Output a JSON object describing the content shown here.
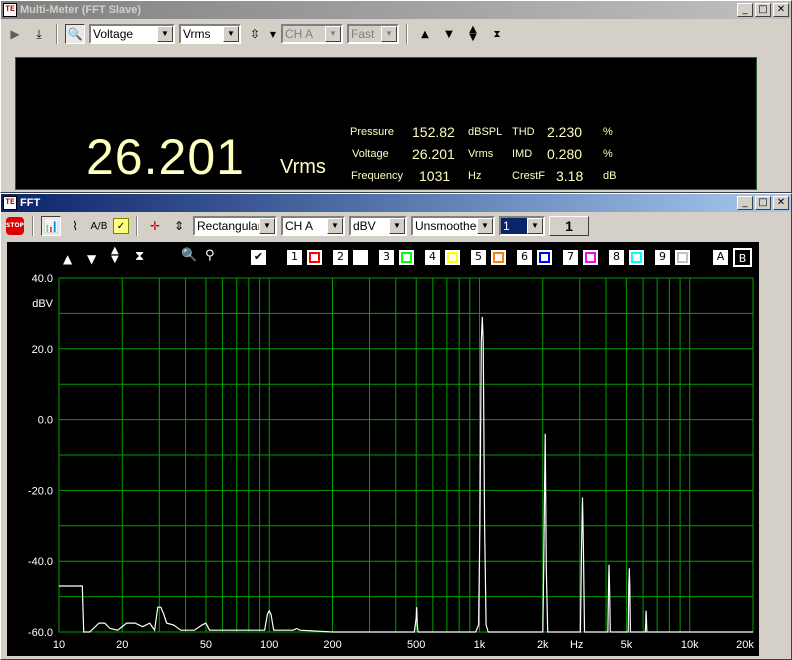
{
  "multimeter": {
    "title": "Multi-Meter (FFT Slave)",
    "window_buttons": [
      "_",
      "□",
      "✕"
    ],
    "toolbar": {
      "measurement": "Voltage",
      "unit": "Vrms",
      "channel": "CH A",
      "speed": "Fast"
    },
    "display": {
      "main_value": "26.201",
      "main_unit": "Vrms",
      "readouts": [
        {
          "label": "Pressure",
          "value": "152.82",
          "unit": "dBSPL"
        },
        {
          "label": "Voltage",
          "value": "26.201",
          "unit": "Vrms"
        },
        {
          "label": "Frequency",
          "value": "1031",
          "unit": "Hz"
        },
        {
          "label": "THD",
          "value": "2.230",
          "unit": "%"
        },
        {
          "label": "IMD",
          "value": "0.280",
          "unit": "%"
        },
        {
          "label": "CrestF",
          "value": "3.18",
          "unit": "dB"
        }
      ]
    }
  },
  "fft": {
    "title": "FFT",
    "window_buttons": [
      "_",
      "□",
      "✕"
    ],
    "toolbar": {
      "stop_label": "STOP",
      "window": "Rectangular",
      "channel": "CH A",
      "unit": "dBV",
      "smoothing": "Unsmoothed",
      "average": "1",
      "average_count": "1"
    },
    "controls": {
      "checkbox": "✔",
      "traces": [
        {
          "num": "1",
          "color": "#ff0000"
        },
        {
          "num": "2",
          "color": "#ffffff"
        },
        {
          "num": "3",
          "color": "#00ff00"
        },
        {
          "num": "4",
          "color": "#ffff00"
        },
        {
          "num": "5",
          "color": "#ff8000"
        },
        {
          "num": "6",
          "color": "#0000ff"
        },
        {
          "num": "7",
          "color": "#ff00ff"
        },
        {
          "num": "8",
          "color": "#00ffff"
        },
        {
          "num": "9",
          "color": "#c0c0c0"
        }
      ],
      "cursor_a": "A",
      "cursor_b": "B"
    }
  },
  "chart_data": {
    "type": "line",
    "xscale": "log",
    "xlim": [
      10,
      20000
    ],
    "ylim": [
      -60,
      40
    ],
    "ylabel": "dBV",
    "xlabel": "Hz",
    "yticks": [
      "40.0",
      "20.0",
      "0.0",
      "-20.0",
      "-40.0",
      "-60.0"
    ],
    "xticks": [
      {
        "v": 10,
        "t": "10"
      },
      {
        "v": 20,
        "t": "20"
      },
      {
        "v": 50,
        "t": "50"
      },
      {
        "v": 100,
        "t": "100"
      },
      {
        "v": 200,
        "t": "200"
      },
      {
        "v": 500,
        "t": "500"
      },
      {
        "v": 1000,
        "t": "1k"
      },
      {
        "v": 2000,
        "t": "2k"
      },
      {
        "v": 5000,
        "t": "5k"
      },
      {
        "v": 10000,
        "t": "10k"
      },
      {
        "v": 20000,
        "t": "20k"
      }
    ],
    "grid": true,
    "grid_color": "#00a000",
    "series": [
      {
        "color": "#ffffff",
        "points": [
          [
            10,
            -47
          ],
          [
            12.9,
            -47
          ],
          [
            13.1,
            -60
          ],
          [
            14,
            -60
          ],
          [
            15.5,
            -57.5
          ],
          [
            16.5,
            -57.5
          ],
          [
            17.5,
            -59
          ],
          [
            19,
            -59.5
          ],
          [
            21,
            -57.5
          ],
          [
            23,
            -57.5
          ],
          [
            25,
            -58.5
          ],
          [
            27,
            -57.5
          ],
          [
            28.5,
            -59.5
          ],
          [
            29.5,
            -53
          ],
          [
            30.5,
            -53
          ],
          [
            31.5,
            -55
          ],
          [
            32.5,
            -57.5
          ],
          [
            35,
            -58
          ],
          [
            38,
            -59.5
          ],
          [
            44,
            -59.5
          ],
          [
            48,
            -58
          ],
          [
            50,
            -57.5
          ],
          [
            52,
            -59.5
          ],
          [
            75,
            -59.5
          ],
          [
            95,
            -59.5
          ],
          [
            98,
            -55
          ],
          [
            100,
            -54
          ],
          [
            102,
            -55
          ],
          [
            105,
            -59.5
          ],
          [
            130,
            -59.5
          ],
          [
            135,
            -59
          ],
          [
            140,
            -59.5
          ],
          [
            200,
            -60
          ],
          [
            490,
            -60
          ],
          [
            500,
            -56
          ],
          [
            503,
            -53
          ],
          [
            506,
            -58
          ],
          [
            510,
            -60
          ],
          [
            960,
            -60
          ],
          [
            990,
            -58
          ],
          [
            1005,
            -30
          ],
          [
            1020,
            22
          ],
          [
            1031,
            29
          ],
          [
            1042,
            22
          ],
          [
            1058,
            -30
          ],
          [
            1075,
            -58
          ],
          [
            1100,
            -60
          ],
          [
            2000,
            -60
          ],
          [
            2020,
            -42
          ],
          [
            2055,
            -4
          ],
          [
            2080,
            -42
          ],
          [
            2110,
            -60
          ],
          [
            3020,
            -60
          ],
          [
            3060,
            -35
          ],
          [
            3090,
            -22
          ],
          [
            3120,
            -36
          ],
          [
            3160,
            -60
          ],
          [
            3150,
            -60
          ],
          [
            4080,
            -60
          ],
          [
            4110,
            -48
          ],
          [
            4130,
            -41
          ],
          [
            4160,
            -48
          ],
          [
            4190,
            -60
          ],
          [
            5100,
            -60
          ],
          [
            5130,
            -47
          ],
          [
            5160,
            -42
          ],
          [
            5190,
            -47
          ],
          [
            5220,
            -60
          ],
          [
            6150,
            -60
          ],
          [
            6180,
            -57
          ],
          [
            6200,
            -54
          ],
          [
            6230,
            -57
          ],
          [
            6260,
            -60
          ],
          [
            20000,
            -60
          ]
        ]
      }
    ]
  }
}
